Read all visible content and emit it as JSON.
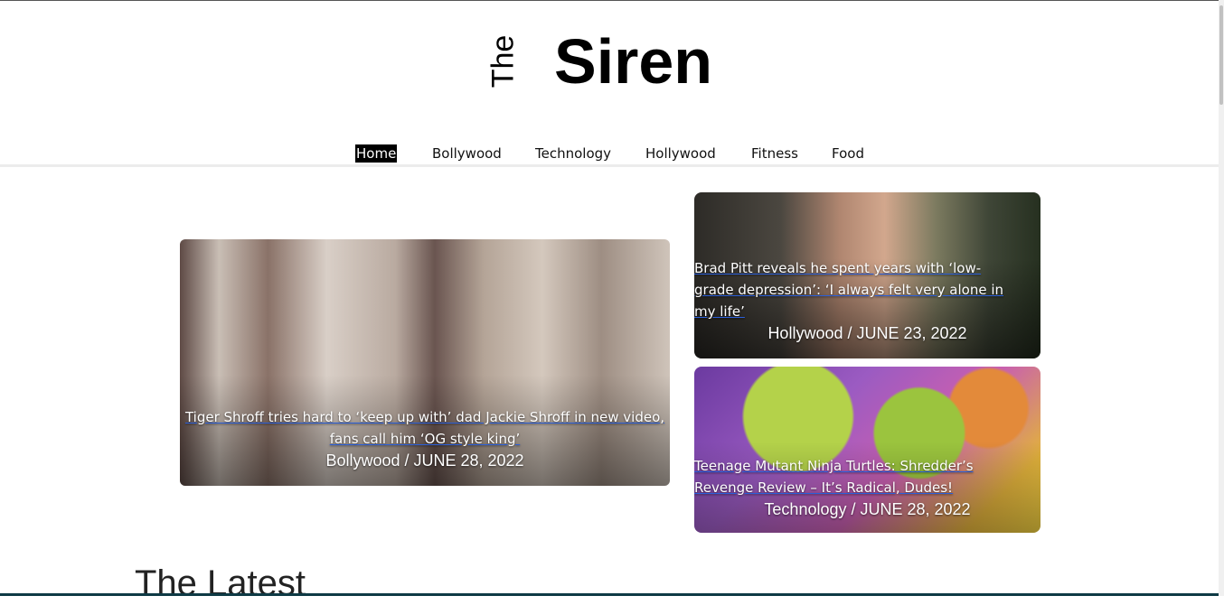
{
  "brand": {
    "prefix": "The",
    "name": "Siren"
  },
  "nav": {
    "items": [
      {
        "label": "Home",
        "active": true
      },
      {
        "label": "Bollywood",
        "active": false
      },
      {
        "label": "Technology",
        "active": false
      },
      {
        "label": "Hollywood",
        "active": false
      },
      {
        "label": "Fitness",
        "active": false
      },
      {
        "label": "Food",
        "active": false
      }
    ]
  },
  "featured": {
    "main": {
      "title": "Tiger Shroff tries hard to ‘keep up with’ dad Jackie Shroff in new video, fans call him ‘OG style king’",
      "meta": "Bollywood / JUNE 28, 2022"
    },
    "side": [
      {
        "title": "Brad Pitt reveals he spent years with ‘low-grade depression’: ‘I always felt very alone in my life’",
        "meta": "Hollywood / JUNE 23, 2022"
      },
      {
        "title": "Teenage Mutant Ninja Turtles: Shredder’s Revenge Review – It’s Radical, Dudes!",
        "meta": "Technology / JUNE 28, 2022"
      }
    ]
  },
  "latest": {
    "heading": "The Latest"
  },
  "colors": {
    "accent": "#000000",
    "link_underline": "#2b5fd9",
    "footer_line": "#0e3a45"
  }
}
